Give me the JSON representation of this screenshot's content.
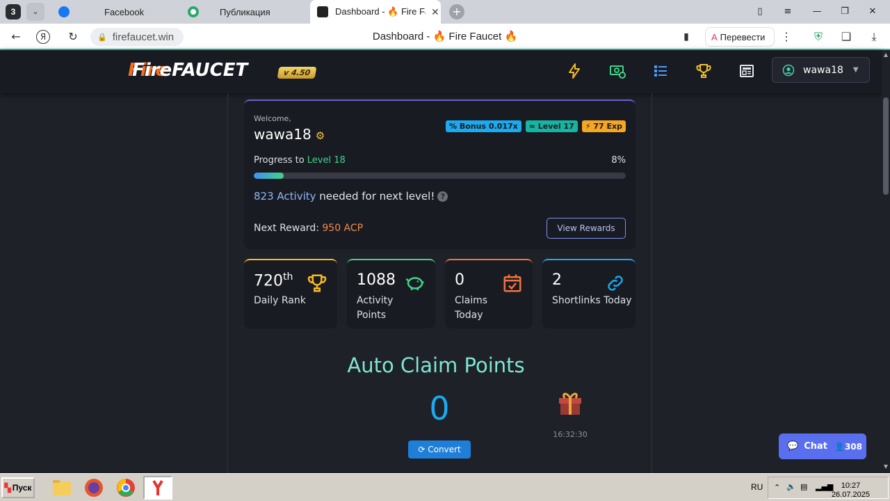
{
  "browser": {
    "tab_counter": "3",
    "tabs": [
      {
        "label": "Facebook"
      },
      {
        "label": "Публикация"
      },
      {
        "label": "Dashboard - 🔥 Fire Fau"
      }
    ],
    "url": "firefaucet.win",
    "page_title": "Dashboard - 🔥 Fire Faucet 🔥",
    "translate_label": "Перевести"
  },
  "header": {
    "logo_fire": "Fire",
    "logo_faucet": "FAUCET",
    "version": "v 4.50",
    "username": "wawa18"
  },
  "welcome": {
    "greeting": "Welcome,",
    "username": "wawa18",
    "badges": [
      {
        "label": "% Bonus 0.017x",
        "color": "#1ba9f0"
      },
      {
        "label": "≈ Level 17",
        "color": "#16b5a3"
      },
      {
        "label": "⚡ 77 Exp",
        "color": "#f5a623"
      }
    ],
    "progress_prefix": "Progress to ",
    "progress_level": "Level 18",
    "progress_pct_label": "8%",
    "progress_value": 8,
    "activity_amount": "823 Activity",
    "activity_suffix": " needed for next level!",
    "reward_prefix": "Next Reward: ",
    "reward_value": "950 ACP",
    "view_rewards_label": "View Rewards"
  },
  "stats": [
    {
      "value": "720",
      "suffix": "th",
      "label": "Daily Rank",
      "accent": "#f5b923"
    },
    {
      "value": "1088",
      "suffix": "",
      "label": "Activity Points",
      "accent": "#3fd48a"
    },
    {
      "value": "0",
      "suffix": "",
      "label": "Claims Today",
      "accent": "#f3733e"
    },
    {
      "value": "2",
      "suffix": "",
      "label": "Shortlinks Today",
      "accent": "#1ba9f0"
    }
  ],
  "auto_claim": {
    "title": "Auto Claim Points",
    "points": "0",
    "timer": "16:32:30",
    "convert_label": "Convert"
  },
  "chat": {
    "label": "Chat",
    "count": "308"
  },
  "taskbar": {
    "start_label": "Пуск",
    "lang": "RU",
    "time": "10:27",
    "date": "26.07.2025"
  }
}
